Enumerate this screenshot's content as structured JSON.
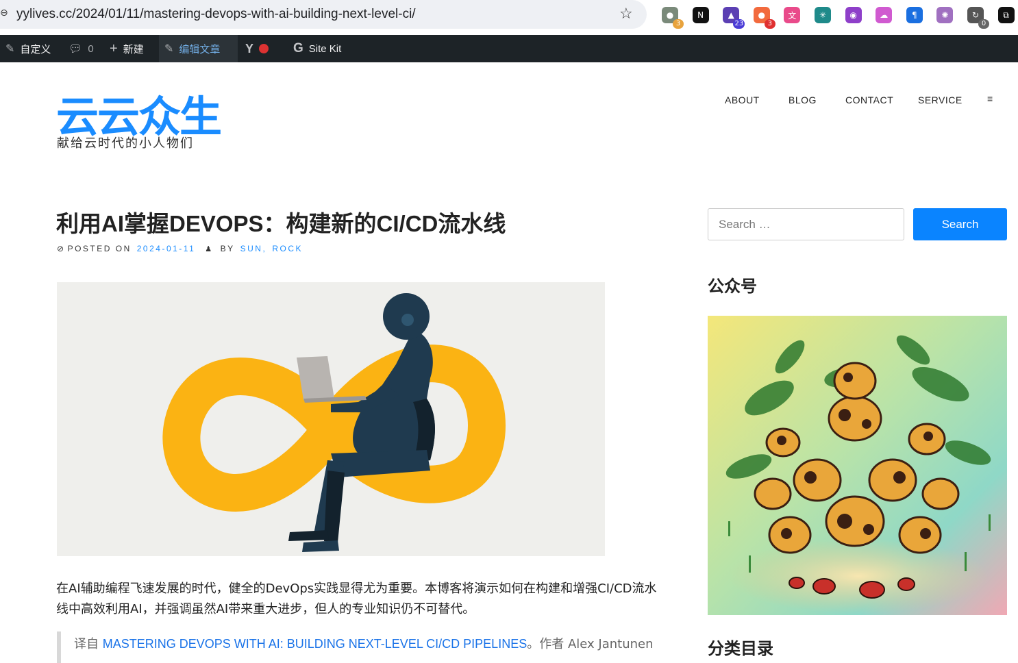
{
  "browser": {
    "url": "yylives.cc/2024/01/11/mastering-devops-with-ai-building-next-level-ci/",
    "extensions": [
      {
        "name": "extension-wechat-icon",
        "glyph": "●",
        "color": "#7a8a7a",
        "badge": "3",
        "badge_color": "#e8a33d"
      },
      {
        "name": "extension-notion-icon",
        "glyph": "N",
        "color": "#111111",
        "badge": "",
        "badge_color": ""
      },
      {
        "name": "extension-scholar-icon",
        "glyph": "▲",
        "color": "#5b3fb3",
        "badge": "23",
        "badge_color": "#4a3bd6"
      },
      {
        "name": "extension-circles-icon",
        "glyph": "●",
        "color": "#f26a3d",
        "badge": "3",
        "badge_color": "#e03030"
      },
      {
        "name": "extension-translate-icon",
        "glyph": "文",
        "color": "#e94a8a",
        "badge": "",
        "badge_color": ""
      },
      {
        "name": "extension-grid-icon",
        "glyph": "✳",
        "color": "#1f8a8a",
        "badge": "",
        "badge_color": ""
      },
      {
        "name": "extension-lr-icon",
        "glyph": "◉",
        "color": "#8e3fc9",
        "badge": "",
        "badge_color": ""
      },
      {
        "name": "extension-cloud-icon",
        "glyph": "☁",
        "color": "#d05ad0",
        "badge": "",
        "badge_color": ""
      },
      {
        "name": "extension-pilcrow-icon",
        "glyph": "¶",
        "color": "#1a6fe0",
        "badge": "",
        "badge_color": ""
      },
      {
        "name": "extension-openai-icon",
        "glyph": "✺",
        "color": "#a070c0",
        "badge": "",
        "badge_color": ""
      },
      {
        "name": "extension-refresh-icon",
        "glyph": "↻",
        "color": "#555555",
        "badge": "0",
        "badge_color": "#666666"
      },
      {
        "name": "extension-puzzle-icon",
        "glyph": "⧉",
        "color": "#111111",
        "badge": "",
        "badge_color": ""
      }
    ]
  },
  "adminbar": {
    "customize": "自定义",
    "comments_count": "0",
    "new": "新建",
    "edit_post": "编辑文章",
    "site_kit": "Site Kit"
  },
  "site": {
    "title": "云云众生",
    "description": "献给云时代的小人物们"
  },
  "nav": {
    "about": "ABOUT",
    "blog": "BLOG",
    "contact": "CONTACT",
    "service": "SERVICE",
    "menu": "≡"
  },
  "post": {
    "title": "利用AI掌握DEVOPS：构建新的CI/CD流水线",
    "posted_on_label": "POSTED ON",
    "date": "2024-01-11",
    "by_label": "BY",
    "author1": "SUN",
    "author_sep": ",",
    "author2": "ROCK",
    "excerpt": "在AI辅助编程飞速发展的时代，健全的DevOps实践显得尤为重要。本博客将演示如何在构建和增强CI/CD流水线中高效利用AI，并强调虽然AI带来重大进步，但人的专业知识仍不可替代。",
    "quote_prefix": "译自 ",
    "quote_link": "MASTERING DEVOPS WITH AI: BUILDING NEXT-LEVEL CI/CD PIPELINES",
    "quote_suffix": "。作者 Alex Jantunen"
  },
  "sidebar": {
    "search_placeholder": "Search …",
    "search_button": "Search",
    "widget1_title": "公众号",
    "widget2_title": "分类目录"
  },
  "colors": {
    "accent": "#1a8cff",
    "adminbar_bg": "#1d2327",
    "infinity": "#fbb313"
  }
}
